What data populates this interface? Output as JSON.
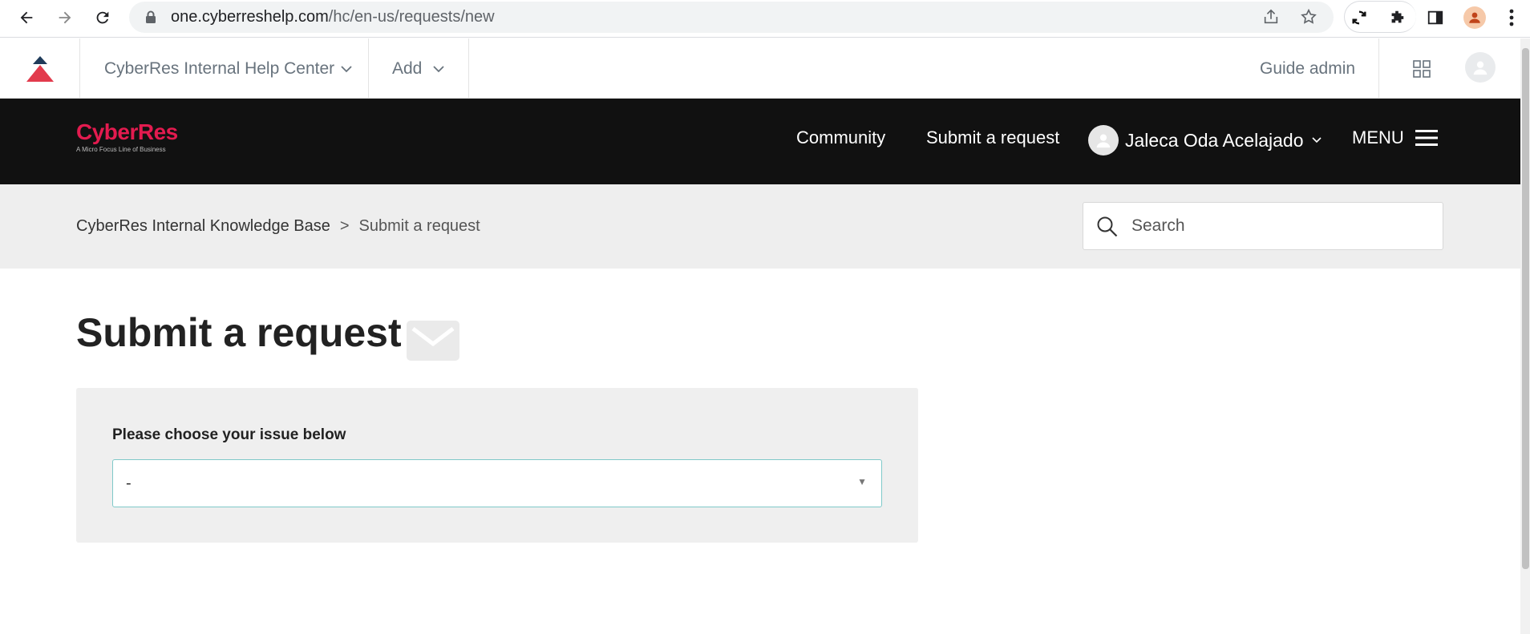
{
  "browser": {
    "url_host": "one.cyberreshelp.com",
    "url_path": "/hc/en-us/requests/new",
    "icons": [
      "back-icon",
      "forward-icon",
      "reload-icon",
      "lock-icon",
      "share-icon",
      "star-icon",
      "sync-icon",
      "extensions-icon",
      "side-panel-icon",
      "profile-icon",
      "more-icon"
    ]
  },
  "admin_bar": {
    "help_center_label": "CyberRes Internal Help Center",
    "add_label": "Add",
    "guide_admin_label": "Guide admin"
  },
  "header": {
    "brand_name": "CyberRes",
    "brand_tagline": "A Micro Focus Line of Business",
    "brand_color": "#e31b4f",
    "nav": {
      "community": "Community",
      "submit_request": "Submit a request"
    },
    "user_name": "Jaleca Oda Acelajado",
    "menu_label": "MENU"
  },
  "breadcrumb": {
    "home": "CyberRes Internal Knowledge Base",
    "separator": ">",
    "current": "Submit a request"
  },
  "search": {
    "placeholder": "Search"
  },
  "main": {
    "title": "Submit a request",
    "form": {
      "issue_label": "Please choose your issue below",
      "issue_value": "-"
    }
  }
}
